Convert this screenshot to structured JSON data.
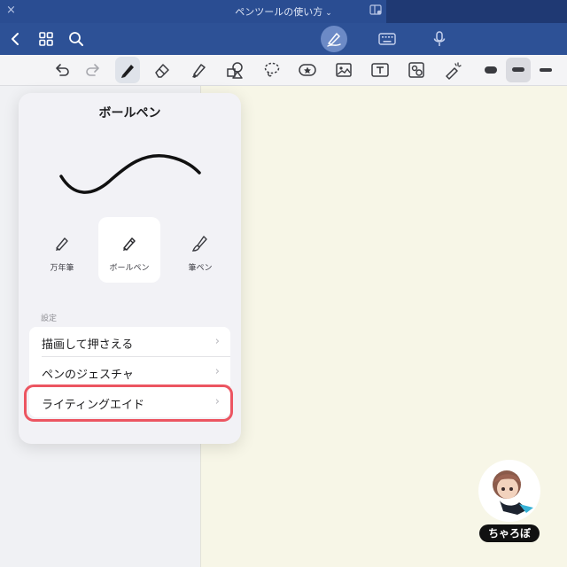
{
  "titlebar": {
    "close_glyph": "×",
    "title": "ペンツールの使い方",
    "title_chevron": "⌄"
  },
  "colors": {
    "titlebar": "#2a4d92",
    "navbar": "#2d5196",
    "page": "#f7f6e7",
    "highlight": "#ec5561"
  },
  "popover": {
    "title": "ボールペン",
    "pen_types": [
      {
        "label": "万年筆",
        "icon": "fountain-pen-icon"
      },
      {
        "label": "ボールペン",
        "icon": "ballpoint-pen-icon"
      },
      {
        "label": "筆ペン",
        "icon": "brush-pen-icon"
      }
    ],
    "section_label": "設定",
    "rows": [
      {
        "label": "描画して押さえる",
        "chevron": "›"
      },
      {
        "label": "ペンのジェスチャ",
        "chevron": "›"
      },
      {
        "label": "ライティングエイド",
        "chevron": "›"
      }
    ]
  },
  "avatar": {
    "name": "ちゃろぼ"
  }
}
